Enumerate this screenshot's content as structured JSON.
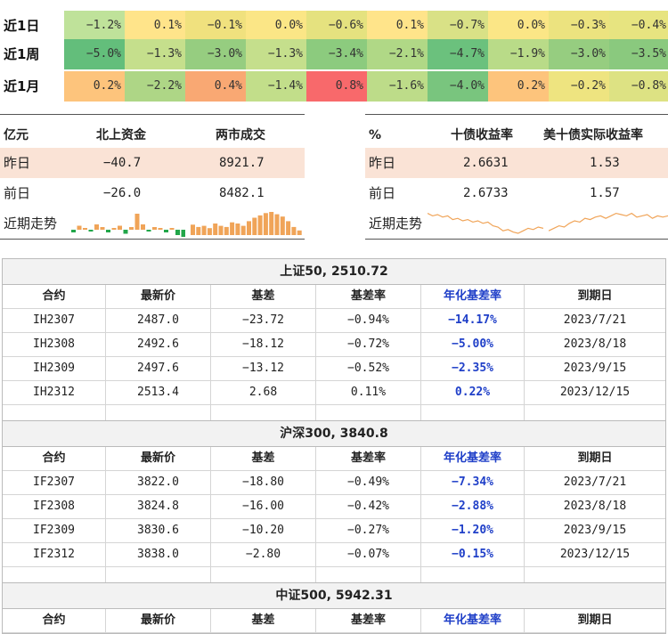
{
  "heatmap": {
    "rows": [
      {
        "label": "近1日",
        "values": [
          "−1.2%",
          "0.1%",
          "−0.1%",
          "0.0%",
          "−0.6%",
          "0.1%",
          "−0.7%",
          "0.0%",
          "−0.3%",
          "−0.4%"
        ],
        "colors": [
          "#bfe29a",
          "#ffe48a",
          "#f0e17e",
          "#fbe686",
          "#e5e27f",
          "#ffe48a",
          "#d9e186",
          "#fbe686",
          "#ece37f",
          "#e7e480"
        ]
      },
      {
        "label": "近1周",
        "values": [
          "−5.0%",
          "−1.3%",
          "−3.0%",
          "−1.3%",
          "−3.4%",
          "−2.1%",
          "−4.7%",
          "−1.9%",
          "−3.0%",
          "−3.5%"
        ],
        "colors": [
          "#63be7b",
          "#c5df8c",
          "#96cd80",
          "#c5df8c",
          "#8ccb7e",
          "#b0d886",
          "#6bc17d",
          "#b9db88",
          "#96cd80",
          "#8ac97e"
        ]
      },
      {
        "label": "近1月",
        "values": [
          "0.2%",
          "−2.2%",
          "0.4%",
          "−1.4%",
          "0.8%",
          "−1.6%",
          "−4.0%",
          "0.2%",
          "−0.2%",
          "−0.8%"
        ],
        "colors": [
          "#fdc47c",
          "#aed686",
          "#f9a873",
          "#c2de8a",
          "#f8696b",
          "#bddc89",
          "#79c57e",
          "#fdc47c",
          "#eee480",
          "#dde283"
        ]
      }
    ]
  },
  "capital": {
    "unit": "亿元",
    "col1": "北上资金",
    "col2": "两市成交",
    "rows": [
      {
        "label": "昨日",
        "v1": "−40.7",
        "v2": "8921.7"
      },
      {
        "label": "前日",
        "v1": "−26.0",
        "v2": "8482.1"
      }
    ],
    "trend_label": "近期走势",
    "north_bars": [
      -0.1,
      0.15,
      0.05,
      -0.05,
      0.2,
      0.1,
      -0.1,
      0.05,
      0.15,
      -0.15,
      0.1,
      0.6,
      0.2,
      -0.05,
      0.1,
      0.05,
      -0.1,
      0.05,
      -0.2,
      -0.35
    ],
    "turnover_bars": [
      0.45,
      0.35,
      0.4,
      0.3,
      0.5,
      0.4,
      0.35,
      0.55,
      0.5,
      0.4,
      0.6,
      0.75,
      0.85,
      0.95,
      1.0,
      0.9,
      0.8,
      0.6,
      0.35,
      0.2
    ],
    "north_pos_color": "#f0a458",
    "north_neg_color": "#22a64a",
    "turnover_color": "#f0a458"
  },
  "bonds": {
    "unit": "%",
    "col1": "十债收益率",
    "col2": "美十债实际收益率",
    "rows": [
      {
        "label": "昨日",
        "v1": "2.6631",
        "v2": "1.53"
      },
      {
        "label": "前日",
        "v1": "2.6733",
        "v2": "1.57"
      }
    ],
    "trend_label": "近期走势",
    "line1": [
      0.2,
      0.3,
      0.25,
      0.35,
      0.3,
      0.45,
      0.4,
      0.5,
      0.45,
      0.55,
      0.5,
      0.6,
      0.55,
      0.7,
      0.75,
      0.9,
      0.85,
      0.95,
      1.0,
      0.9,
      0.8,
      0.85,
      0.75,
      0.8
    ],
    "line2": [
      0.9,
      0.8,
      0.7,
      0.75,
      0.6,
      0.5,
      0.55,
      0.4,
      0.45,
      0.35,
      0.3,
      0.4,
      0.3,
      0.2,
      0.25,
      0.3,
      0.2,
      0.35,
      0.3,
      0.25,
      0.4,
      0.3,
      0.35,
      0.3
    ],
    "line_color": "#f0a458"
  },
  "futures": [
    {
      "title": "上证50, 2510.72",
      "headers": [
        "合约",
        "最新价",
        "基差",
        "基差率",
        "年化基差率",
        "到期日"
      ],
      "rows": [
        [
          "IH2307",
          "2487.0",
          "−23.72",
          "−0.94%",
          "−14.17%",
          "2023/7/21"
        ],
        [
          "IH2308",
          "2492.6",
          "−18.12",
          "−0.72%",
          "−5.00%",
          "2023/8/18"
        ],
        [
          "IH2309",
          "2497.6",
          "−13.12",
          "−0.52%",
          "−2.35%",
          "2023/9/15"
        ],
        [
          "IH2312",
          "2513.4",
          "2.68",
          "0.11%",
          "0.22%",
          "2023/12/15"
        ],
        [
          "",
          "",
          "",
          "",
          "",
          ""
        ]
      ]
    },
    {
      "title": "沪深300, 3840.8",
      "headers": [
        "合约",
        "最新价",
        "基差",
        "基差率",
        "年化基差率",
        "到期日"
      ],
      "rows": [
        [
          "IF2307",
          "3822.0",
          "−18.80",
          "−0.49%",
          "−7.34%",
          "2023/7/21"
        ],
        [
          "IF2308",
          "3824.8",
          "−16.00",
          "−0.42%",
          "−2.88%",
          "2023/8/18"
        ],
        [
          "IF2309",
          "3830.6",
          "−10.20",
          "−0.27%",
          "−1.20%",
          "2023/9/15"
        ],
        [
          "IF2312",
          "3838.0",
          "−2.80",
          "−0.07%",
          "−0.15%",
          "2023/12/15"
        ],
        [
          "",
          "",
          "",
          "",
          "",
          ""
        ]
      ]
    },
    {
      "title": "中证500, 5942.31",
      "headers": [
        "合约",
        "最新价",
        "基差",
        "基差率",
        "年化基差率",
        "到期日"
      ],
      "rows": []
    }
  ]
}
